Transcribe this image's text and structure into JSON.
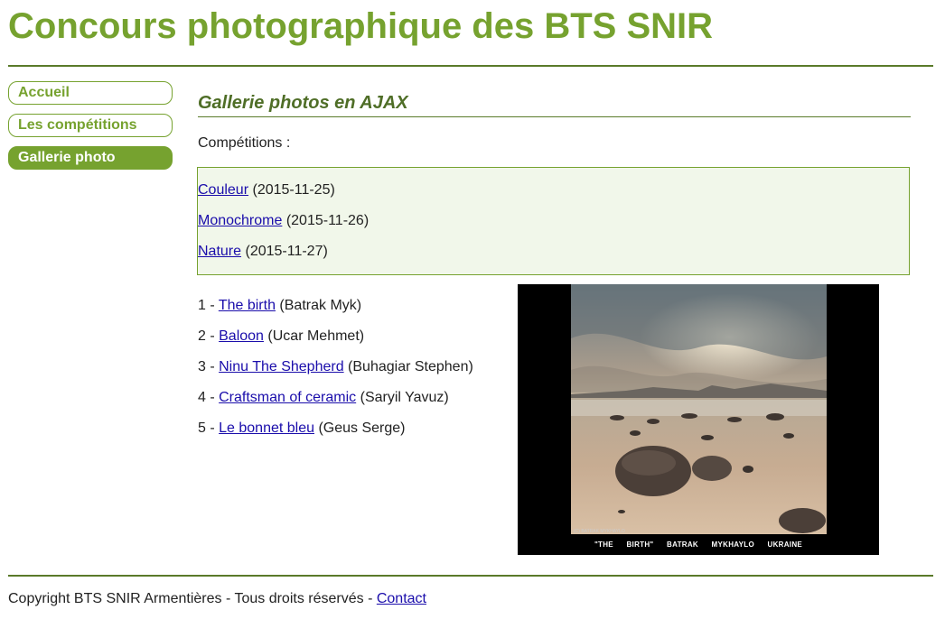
{
  "header": {
    "title": "Concours photographique des BTS SNIR"
  },
  "nav": {
    "items": [
      {
        "label": "Accueil",
        "active": false
      },
      {
        "label": "Les compétitions",
        "active": false
      },
      {
        "label": "Gallerie photo",
        "active": true
      }
    ]
  },
  "main": {
    "section_title": "Gallerie photos en AJAX",
    "competitions_label": "Compétitions :",
    "competitions": [
      {
        "name": "Couleur",
        "date": "(2015-11-25)"
      },
      {
        "name": "Monochrome",
        "date": "(2015-11-26)"
      },
      {
        "name": "Nature",
        "date": "(2015-11-27)"
      }
    ],
    "photos": [
      {
        "rank": "1 -",
        "title": "The birth",
        "author": "(Batrak Myk)"
      },
      {
        "rank": "2 -",
        "title": "Baloon",
        "author": "(Ucar Mehmet)"
      },
      {
        "rank": "3 -",
        "title": "Ninu The Shepherd",
        "author": "(Buhagiar Stephen)"
      },
      {
        "rank": "4 -",
        "title": "Craftsman of ceramic",
        "author": "(Saryil Yavuz)"
      },
      {
        "rank": "5 -",
        "title": "Le bonnet bleu",
        "author": "(Geus Serge)"
      }
    ],
    "preview": {
      "caption": "\"THE BIRTH\" BATRAK MYKHAYLO UKRAINE",
      "copyright": "(C) BATRAK MYKHAYLO"
    }
  },
  "footer": {
    "text": "Copyright BTS SNIR Armentières - Tous droits réservés -",
    "contact_label": "Contact"
  },
  "colors": {
    "accent": "#76a22f",
    "heading": "#4f6e27",
    "box_bg": "#f1f7ea",
    "link": "#1a0dab"
  }
}
